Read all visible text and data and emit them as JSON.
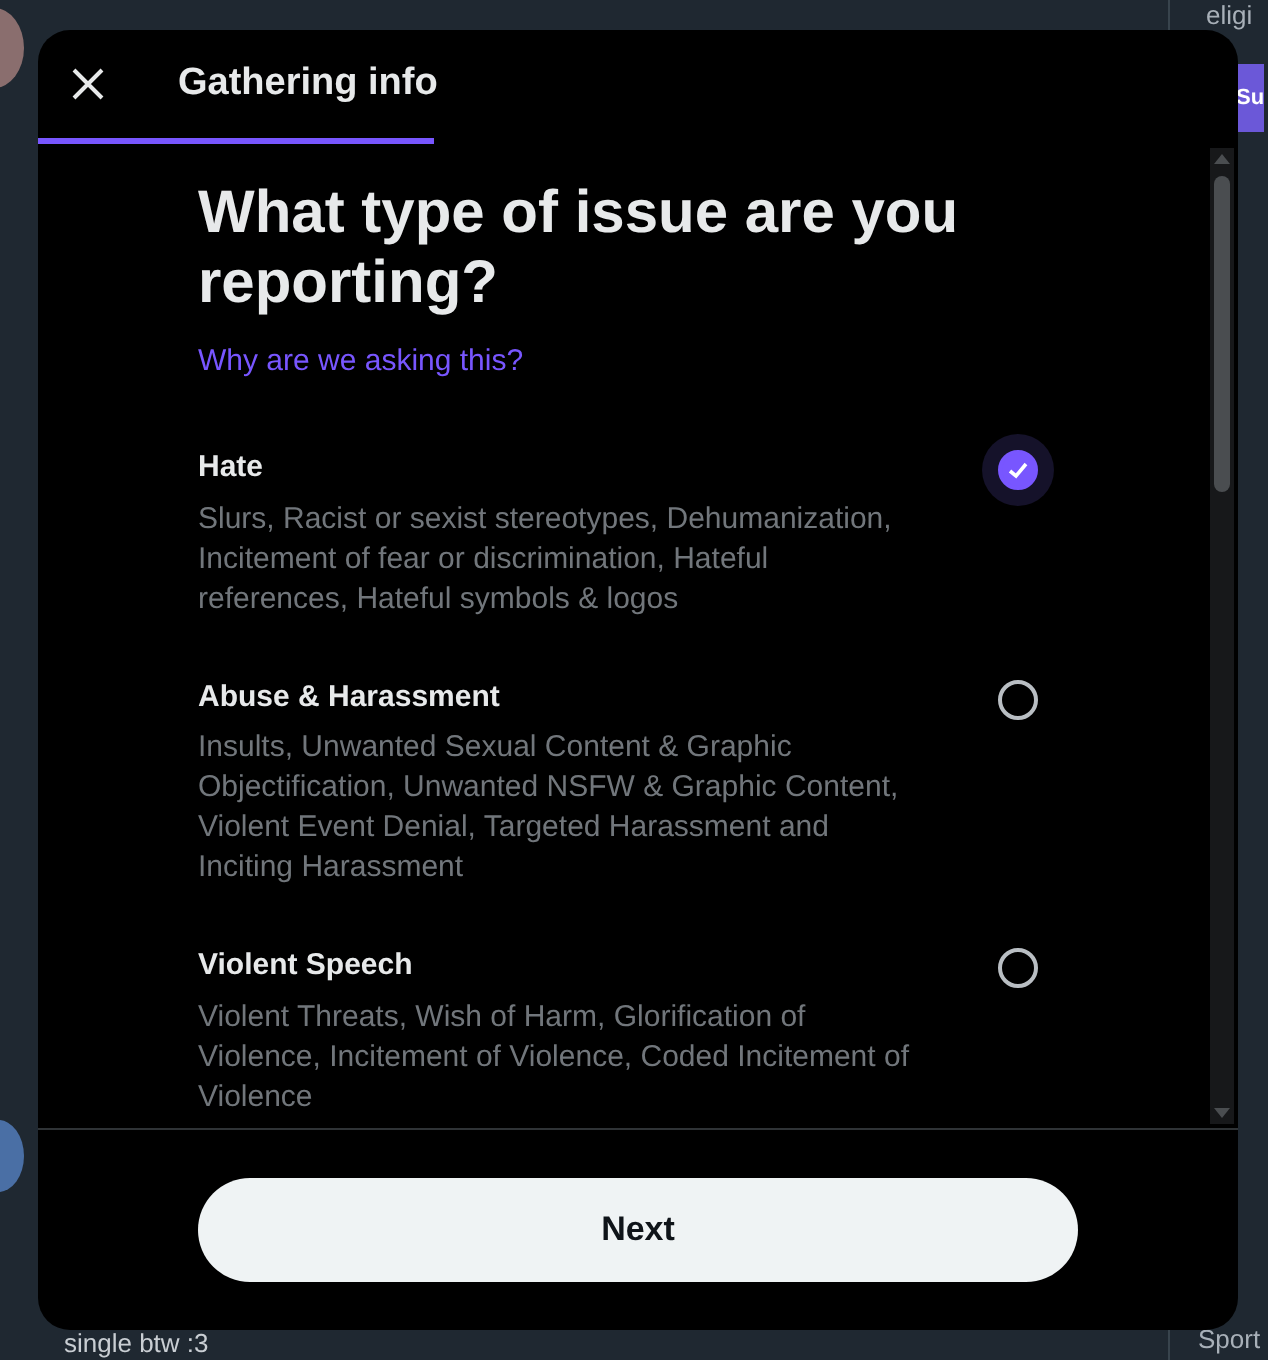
{
  "background": {
    "top_right": "eligi",
    "subscribe": "Su",
    "reply_text": "single btw :3",
    "bottom_right": "Sport"
  },
  "dialog": {
    "title": "Gathering info",
    "progress": {
      "level": 0.33
    },
    "heading": "What type of issue are you reporting?",
    "why_link": "Why are we asking this?",
    "options": [
      {
        "title": "Hate",
        "description": "Slurs, Racist or sexist stereotypes, Dehumanization, Incitement of fear or discrimination, Hateful references, Hateful symbols & logos",
        "selected": true
      },
      {
        "title": "Abuse & Harassment",
        "description": "Insults, Unwanted Sexual Content & Graphic Objectification, Unwanted NSFW & Graphic Content, Violent Event Denial, Targeted Harassment and Inciting Harassment",
        "selected": false
      },
      {
        "title": "Violent Speech",
        "description": "Violent Threats, Wish of Harm, Glorification of Violence, Incitement of Violence, Coded Incitement of Violence",
        "selected": false
      }
    ],
    "next_button": "Next"
  }
}
